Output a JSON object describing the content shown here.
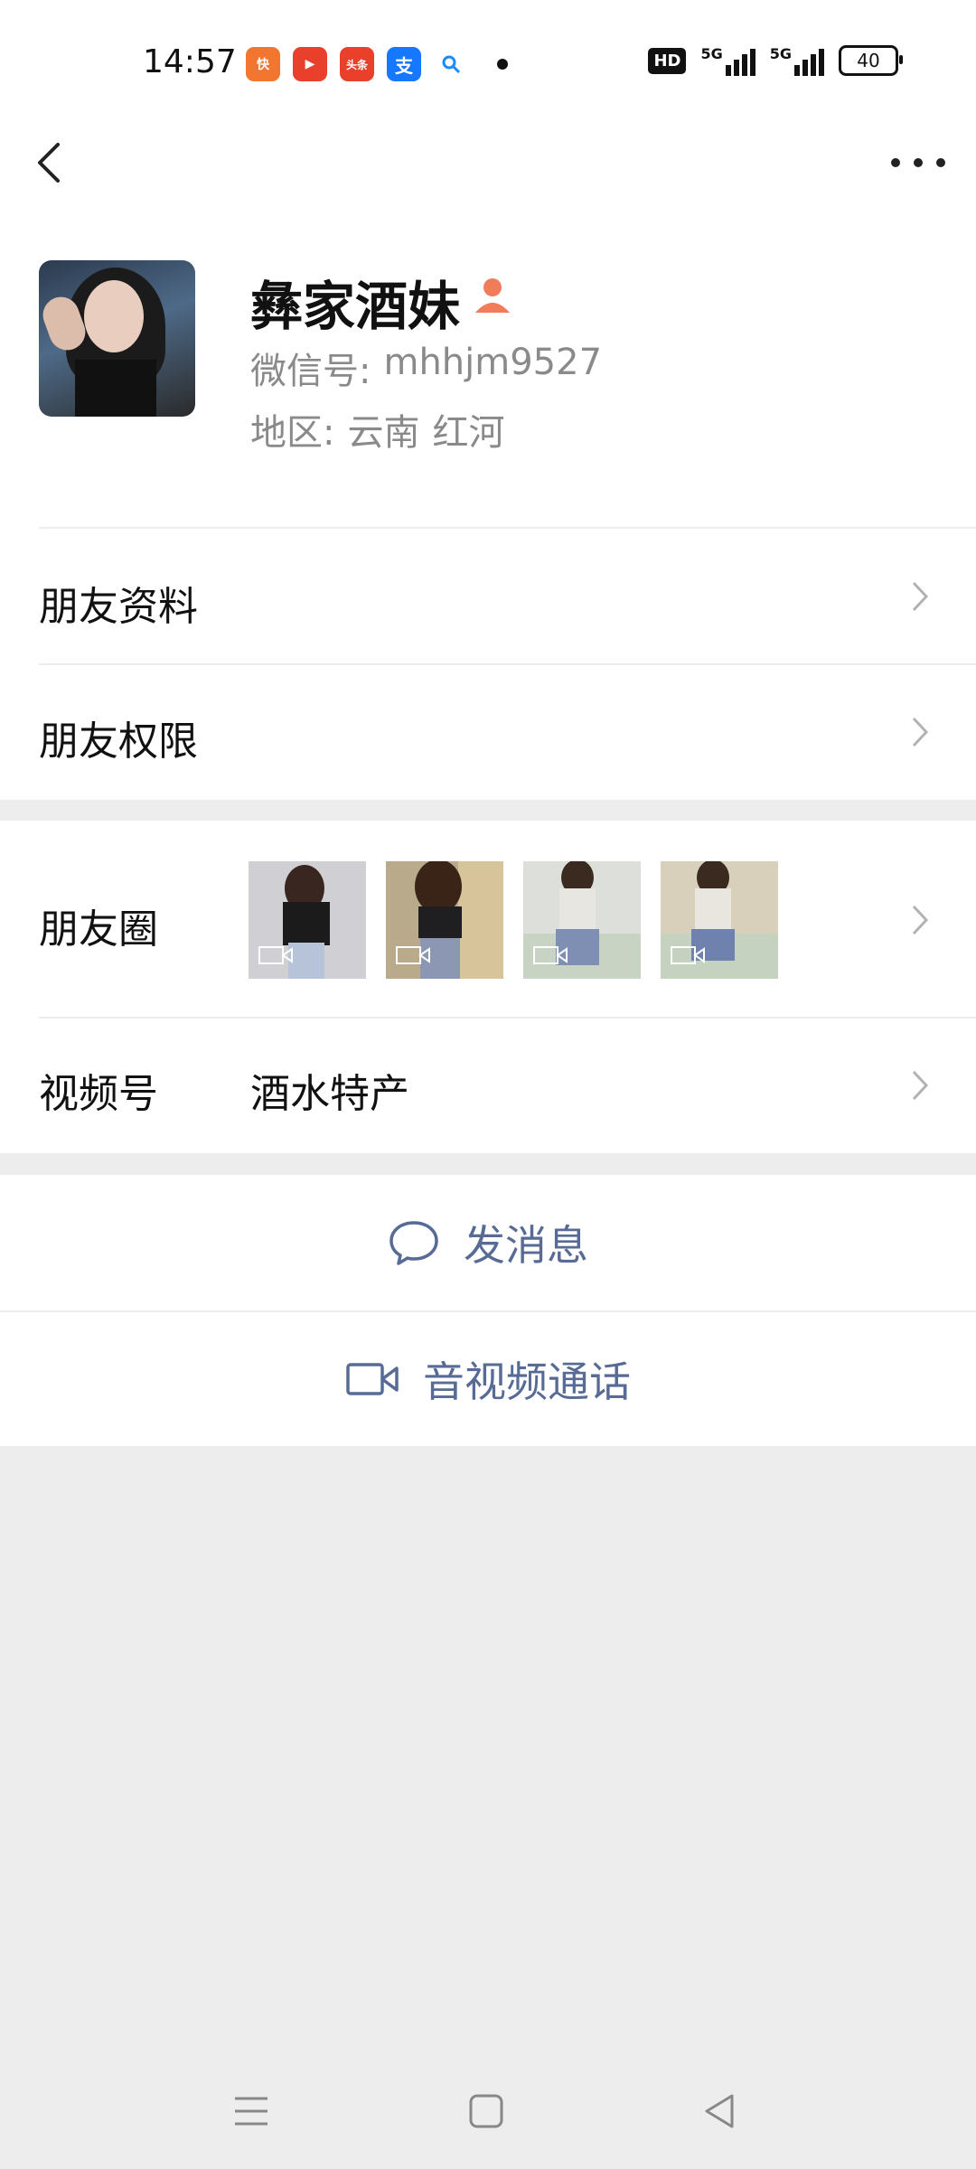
{
  "status_bar": {
    "time": "14:57",
    "apps": [
      {
        "name": "kuaishou-icon",
        "color": "#f2762f",
        "label": "快"
      },
      {
        "name": "video-player-icon",
        "color": "#e8402b",
        "label": "▶"
      },
      {
        "name": "toutiao-icon",
        "color": "#e8402b",
        "label": "头条"
      },
      {
        "name": "alipay-icon",
        "color": "#1677ff",
        "label": "支"
      },
      {
        "name": "search-app-icon",
        "color": "#ffffff",
        "label": "🔍"
      }
    ],
    "hd": "HD",
    "net1": "5G",
    "net2": "5G",
    "battery": "40"
  },
  "profile": {
    "name": "彝家酒妹",
    "wechat_id_label": "微信号:",
    "wechat_id": "mhhjm9527",
    "region_label": "地区:",
    "region_province": "云南",
    "region_city": "红河"
  },
  "rows": {
    "friend_info": "朋友资料",
    "friend_permissions": "朋友权限",
    "moments": "朋友圈",
    "channels": "视频号",
    "channels_value": "酒水特产"
  },
  "moments_thumbs": [
    {
      "name": "moments-thumb-1",
      "bg": "#cfcfd4",
      "body": "#1b1b1b",
      "legs": "#b7c3d8"
    },
    {
      "name": "moments-thumb-2",
      "bg": "#b9aa8c",
      "body": "#1f1f22",
      "legs": "#8c97b4"
    },
    {
      "name": "moments-thumb-3",
      "bg": "#cdd3c9",
      "body": "#e8e6e1",
      "legs": "#7f8fb4"
    },
    {
      "name": "moments-thumb-4",
      "bg": "#cfc6b2",
      "body": "#e9e6df",
      "legs": "#6f82ae"
    }
  ],
  "actions": {
    "message": "发消息",
    "call": "音视频通话"
  },
  "colors": {
    "link_blue": "#576b95",
    "page_bg": "#ededed",
    "name_icon": "#f07c5a"
  }
}
